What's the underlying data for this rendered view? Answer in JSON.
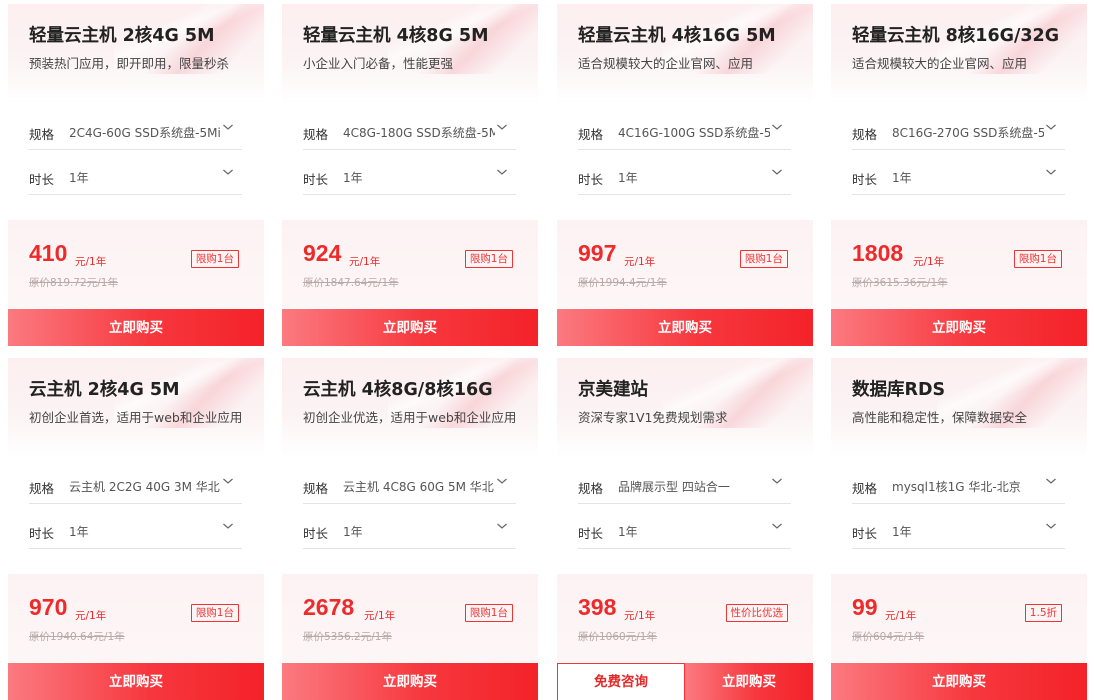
{
  "cards": [
    {
      "title": "轻量云主机 2核4G 5M",
      "subtitle": "预装热门应用，即开即用，限量秒杀",
      "spec_label": "规格",
      "spec_value": "2C4G-60G SSD系统盘-5Mi",
      "duration_label": "时长",
      "duration_value": "1年",
      "price": "410",
      "unit": "元/1年",
      "original": "原价819.72元/1年",
      "badge": "限购1台",
      "buy_label": "立即购买"
    },
    {
      "title": "轻量云主机 4核8G 5M",
      "subtitle": "小企业入门必备，性能更强",
      "spec_label": "规格",
      "spec_value": "4C8G-180G SSD系统盘-5M",
      "duration_label": "时长",
      "duration_value": "1年",
      "price": "924",
      "unit": "元/1年",
      "original": "原价1847.64元/1年",
      "badge": "限购1台",
      "buy_label": "立即购买"
    },
    {
      "title": "轻量云主机 4核16G 5M",
      "subtitle": "适合规模较大的企业官网、应用",
      "spec_label": "规格",
      "spec_value": "4C16G-100G SSD系统盘-5",
      "duration_label": "时长",
      "duration_value": "1年",
      "price": "997",
      "unit": "元/1年",
      "original": "原价1994.4元/1年",
      "badge": "限购1台",
      "buy_label": "立即购买"
    },
    {
      "title": "轻量云主机 8核16G/32G",
      "subtitle": "适合规模较大的企业官网、应用",
      "spec_label": "规格",
      "spec_value": "8C16G-270G SSD系统盘-5",
      "duration_label": "时长",
      "duration_value": "1年",
      "price": "1808",
      "unit": "元/1年",
      "original": "原价3615.36元/1年",
      "badge": "限购1台",
      "buy_label": "立即购买"
    },
    {
      "title": "云主机 2核4G 5M",
      "subtitle": "初创企业首选，适用于web和企业应用",
      "spec_label": "规格",
      "spec_value": "云主机 2C2G 40G 3M 华北",
      "duration_label": "时长",
      "duration_value": "1年",
      "price": "970",
      "unit": "元/1年",
      "original": "原价1940.64元/1年",
      "badge": "限购1台",
      "buy_label": "立即购买"
    },
    {
      "title": "云主机 4核8G/8核16G",
      "subtitle": "初创企业优选，适用于web和企业应用",
      "spec_label": "规格",
      "spec_value": "云主机 4C8G 60G 5M 华北",
      "duration_label": "时长",
      "duration_value": "1年",
      "price": "2678",
      "unit": "元/1年",
      "original": "原价5356.2元/1年",
      "badge": "限购1台",
      "buy_label": "立即购买"
    },
    {
      "title": "京美建站",
      "subtitle": "资深专家1V1免费规划需求",
      "spec_label": "规格",
      "spec_value": "品牌展示型 四站合一",
      "duration_label": "时长",
      "duration_value": "1年",
      "price": "398",
      "unit": "元/1年",
      "original": "原价1060元/1年",
      "badge": "性价比优选",
      "consult_label": "免费咨询",
      "buy_label": "立即购买"
    },
    {
      "title": "数据库RDS",
      "subtitle": "高性能和稳定性，保障数据安全",
      "spec_label": "规格",
      "spec_value": "mysql1核1G 华北-北京",
      "duration_label": "时长",
      "duration_value": "1年",
      "price": "99",
      "unit": "元/1年",
      "original": "原价604元/1年",
      "badge": "1.5折",
      "buy_label": "立即购买"
    }
  ],
  "icons": {
    "dropdown": "chevron-down-icon"
  },
  "colors": {
    "accent": "#ee2a2a",
    "button_start": "#fb7a80",
    "button_end": "#f42229"
  }
}
